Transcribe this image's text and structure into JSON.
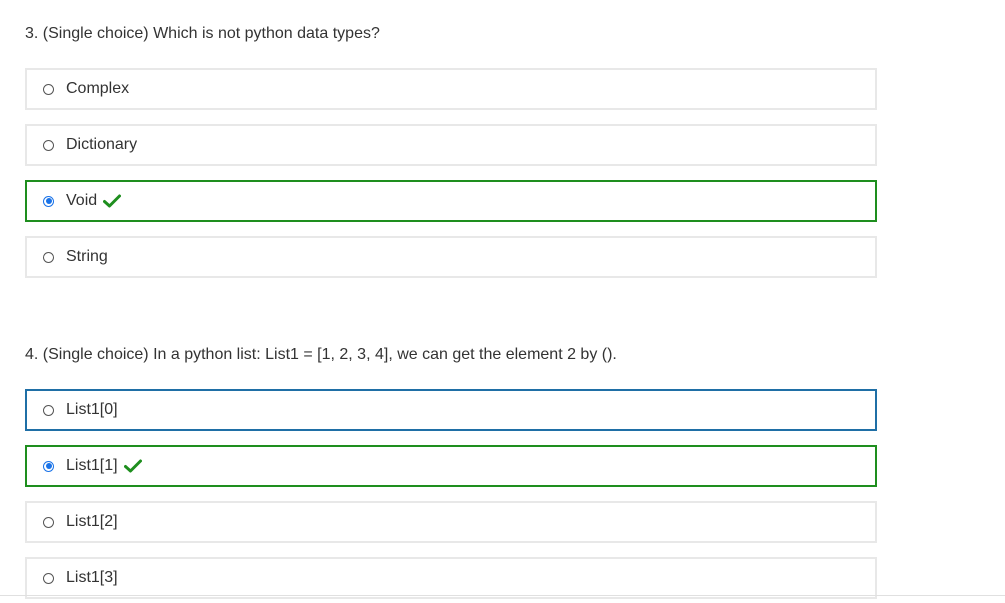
{
  "questions": [
    {
      "text": "3. (Single choice) Which is not python data types?",
      "options": [
        {
          "label": "Complex",
          "selected": false,
          "correct": false
        },
        {
          "label": "Dictionary",
          "selected": false,
          "correct": false
        },
        {
          "label": "Void",
          "selected": true,
          "correct": true
        },
        {
          "label": "String",
          "selected": false,
          "correct": false
        }
      ]
    },
    {
      "text": "4. (Single choice) In a python list: List1 = [1, 2, 3, 4], we can get the element 2 by ().",
      "options": [
        {
          "label": "List1[0]",
          "selected": false,
          "correct": false
        },
        {
          "label": "List1[1]",
          "selected": true,
          "correct": true
        },
        {
          "label": "List1[2]",
          "selected": false,
          "correct": false
        },
        {
          "label": "List1[3]",
          "selected": false,
          "correct": false
        }
      ]
    }
  ],
  "colors": {
    "correct_border": "#1e8e1e",
    "focused_border": "#1f6fa6",
    "radio_checked": "#1a73e8",
    "checkmark": "#1e8e1e"
  },
  "icons": {
    "check": "check-mark-icon",
    "radio": "radio-button-icon"
  }
}
